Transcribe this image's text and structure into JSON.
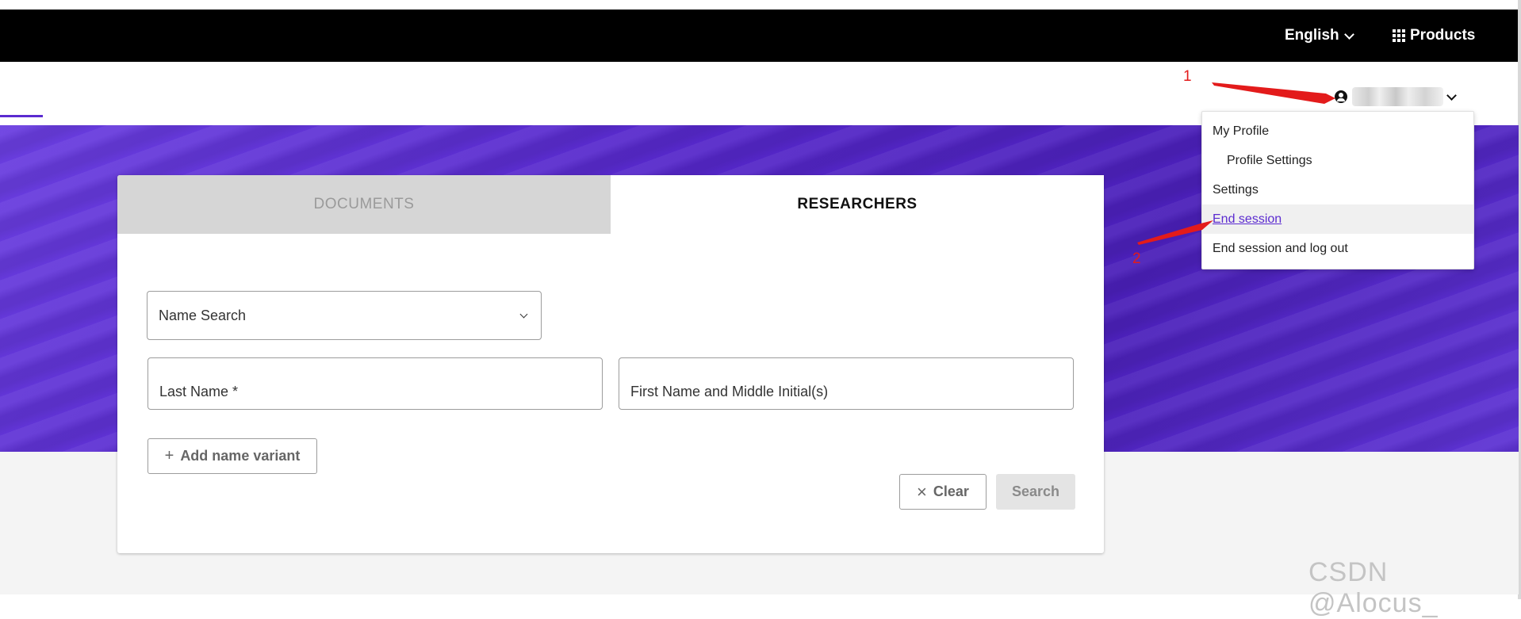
{
  "topbar": {
    "language": "English",
    "products": "Products"
  },
  "user_menu": {
    "items": [
      {
        "label": "My Profile"
      },
      {
        "label": "Profile Settings"
      },
      {
        "label": "Settings"
      },
      {
        "label": "End session"
      },
      {
        "label": "End session and log out"
      }
    ]
  },
  "search_card": {
    "tabs": [
      {
        "label": "DOCUMENTS"
      },
      {
        "label": "RESEARCHERS"
      }
    ],
    "search_type": "Name Search",
    "last_name_placeholder": "Last Name *",
    "first_name_placeholder": "First Name and Middle Initial(s)",
    "add_variant_label": "Add name variant",
    "add_variant_icon": "+",
    "clear_label": "Clear",
    "clear_icon": "×",
    "search_label": "Search"
  },
  "annotations": {
    "marker_1": "1",
    "marker_2": "2",
    "color": "#e31b1b"
  },
  "watermark": "CSDN @Alocus_",
  "colors": {
    "brand_purple": "#5b2bd0",
    "topbar": "#000000"
  }
}
